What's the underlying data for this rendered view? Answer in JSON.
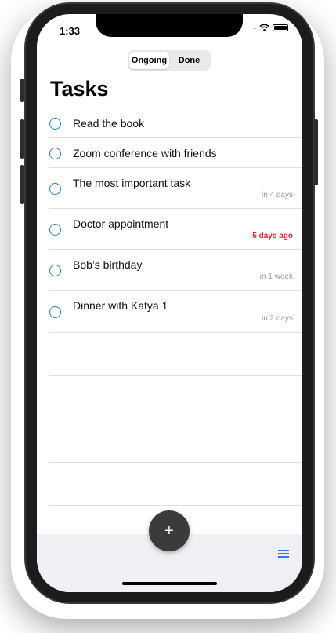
{
  "status_bar": {
    "time": "1:33",
    "signal": "....."
  },
  "segmented_control": {
    "ongoing_label": "Ongoing",
    "done_label": "Done"
  },
  "page_title": "Tasks",
  "tasks": [
    {
      "title": "Read the book",
      "due": ""
    },
    {
      "title": "Zoom conference with friends",
      "due": ""
    },
    {
      "title": "The most important task",
      "due": "in 4 days"
    },
    {
      "title": "Doctor appointment",
      "due": "5 days ago"
    },
    {
      "title": "Bob’s birthday",
      "due": "in 1 week"
    },
    {
      "title": "Dinner with Katya 1",
      "due": "in 2 days"
    }
  ],
  "toolbar": {
    "add_label": "+"
  },
  "colors": {
    "accent": "#2f7cd6",
    "overdue": "#e0282e",
    "fab": "#3b3b3b"
  },
  "icons": {
    "circle": "circle-icon",
    "menu": "menu-icon",
    "wifi": "wifi-icon",
    "battery": "battery-icon"
  }
}
